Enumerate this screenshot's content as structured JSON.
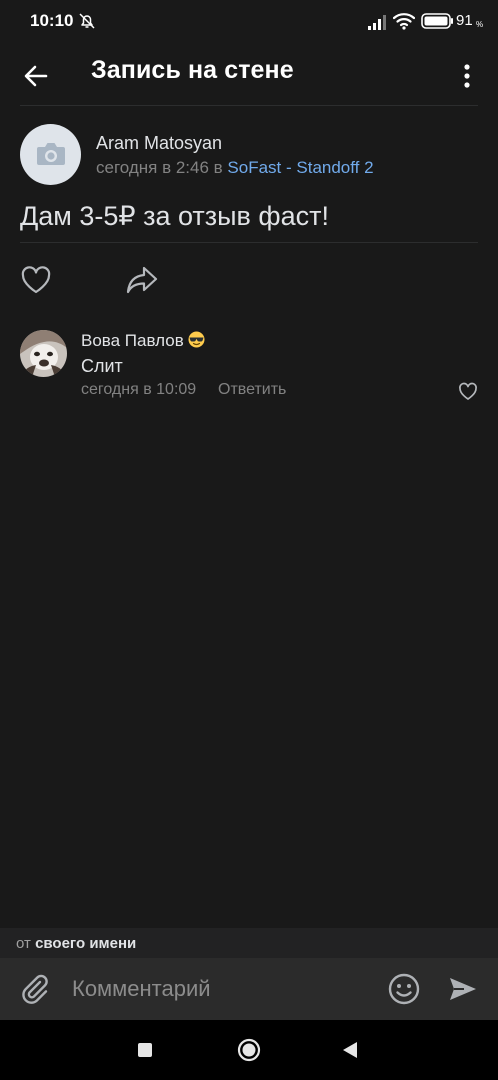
{
  "status_bar": {
    "time": "10:10",
    "battery_percent": "91",
    "battery_suffix": "%"
  },
  "header": {
    "title": "Запись на стене"
  },
  "post": {
    "author": "Aram Matosyan",
    "date": "сегодня в 2:46 в ",
    "group": "SoFast - Standoff 2",
    "text": "Дам 3-5₽ за отзыв фаст!"
  },
  "comments": [
    {
      "author": "Вова Павлов",
      "text": "Слит",
      "date": "сегодня в 10:09",
      "reply_label": "Ответить"
    }
  ],
  "composer": {
    "from_prefix": "от ",
    "from_identity": "своего имени",
    "placeholder": "Комментарий"
  },
  "colors": {
    "background": "#191919",
    "link": "#71aaeb",
    "secondary_text": "#828282",
    "input_bar": "#2b2b2b"
  }
}
